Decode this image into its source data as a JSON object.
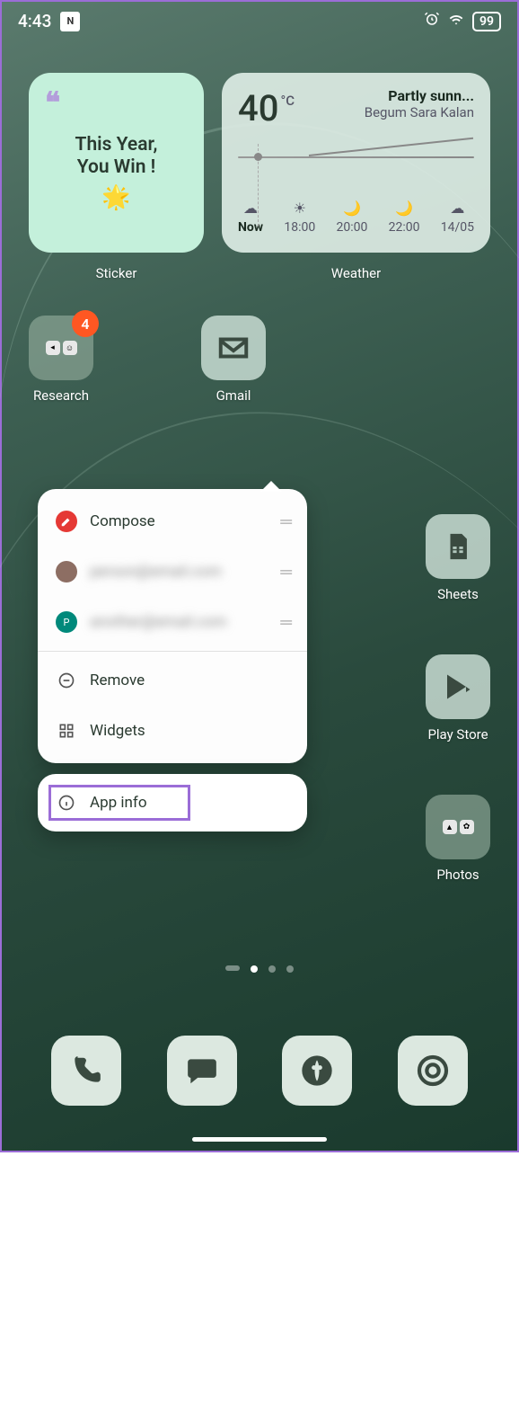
{
  "status": {
    "time": "4:43",
    "battery": "99"
  },
  "sticker": {
    "line1": "This Year,",
    "line2": "You Win !",
    "label": "Sticker"
  },
  "weather": {
    "temp": "40",
    "unit": "°C",
    "condition": "Partly sunn...",
    "location": "Begum Sara Kalan",
    "times": [
      "Now",
      "18:00",
      "20:00",
      "22:00",
      "14/05"
    ],
    "label": "Weather"
  },
  "apps": {
    "research": {
      "label": "Research",
      "badge": "4"
    },
    "gmail": {
      "label": "Gmail"
    },
    "sheets": {
      "label": "Sheets"
    },
    "playstore": {
      "label": "Play Store"
    },
    "photos": {
      "label": "Photos"
    }
  },
  "popup": {
    "compose": "Compose",
    "account1": "",
    "account2": "",
    "remove": "Remove",
    "widgets": "Widgets",
    "appinfo": "App info"
  }
}
